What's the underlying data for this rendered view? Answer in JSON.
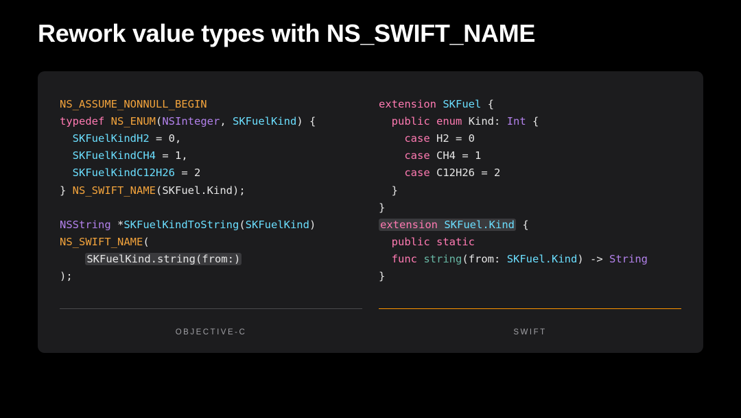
{
  "title": "Rework value types with NS_SWIFT_NAME",
  "left": {
    "label": "OBJECTIVE-C",
    "line1_macro": "NS_ASSUME_NONNULL_BEGIN",
    "line2_typedef": "typedef",
    "line2_nsenum": " NS_ENUM",
    "line2_open": "(",
    "line2_int": "NSInteger",
    "line2_comma": ", ",
    "line2_type": "SKFuelKind",
    "line2_close": ") {",
    "line3_indent": "  ",
    "line3_item": "SKFuelKindH2",
    "line3_eq": " = ",
    "line3_val": "0",
    "line3_comma": ",",
    "line4_indent": "  ",
    "line4_item": "SKFuelKindCH4",
    "line4_eq": " = ",
    "line4_val": "1",
    "line4_comma": ",",
    "line5_indent": "  ",
    "line5_item": "SKFuelKindC12H26",
    "line5_eq": " = ",
    "line5_val": "2",
    "line6_brace": "} ",
    "line6_swiftname": "NS_SWIFT_NAME",
    "line6_args": "(SKFuel.Kind);",
    "line8_nsstring": "NSString",
    "line8_star": " *",
    "line8_fn": "SKFuelKindToString",
    "line8_open": "(",
    "line8_param": "SKFuelKind",
    "line8_close": ")",
    "line9_swiftname": "NS_SWIFT_NAME",
    "line9_open": "(",
    "line10_indent": "    ",
    "line10_hl": "SKFuelKind.string(from:)",
    "line11_close": ");"
  },
  "right": {
    "label": "SWIFT",
    "line1_ext": "extension",
    "line1_sp": " ",
    "line1_type": "SKFuel",
    "line1_brace": " {",
    "line2_indent": "  ",
    "line2_public": "public",
    "line2_sp1": " ",
    "line2_enum": "enum",
    "line2_sp2": " ",
    "line2_kind": "Kind",
    "line2_colon": ": ",
    "line2_int": "Int",
    "line2_brace": " {",
    "line3_indent": "    ",
    "line3_case": "case",
    "line3_sp": " ",
    "line3_name": "H2",
    "line3_eq": " = ",
    "line3_val": "0",
    "line4_indent": "    ",
    "line4_case": "case",
    "line4_sp": " ",
    "line4_name": "CH4",
    "line4_eq": " = ",
    "line4_val": "1",
    "line5_indent": "    ",
    "line5_case": "case",
    "line5_sp": " ",
    "line5_name": "C12H26",
    "line5_eq": " = ",
    "line5_val": "2",
    "line6_indent": "  ",
    "line6_brace": "}",
    "line7_brace": "}",
    "line8_hl_ext": "extension",
    "line8_hl_sp": " ",
    "line8_hl_type": "SKFuel.Kind",
    "line8_brace": " {",
    "line9_indent": "  ",
    "line9_public": "public",
    "line9_sp": " ",
    "line9_static": "static",
    "line10_indent": "  ",
    "line10_func": "func",
    "line10_sp": " ",
    "line10_name": "string",
    "line10_open": "(",
    "line10_from": "from",
    "line10_colon": ": ",
    "line10_param": "SKFuel.Kind",
    "line10_close": ") -> ",
    "line10_ret": "String",
    "line11_brace": "}"
  }
}
